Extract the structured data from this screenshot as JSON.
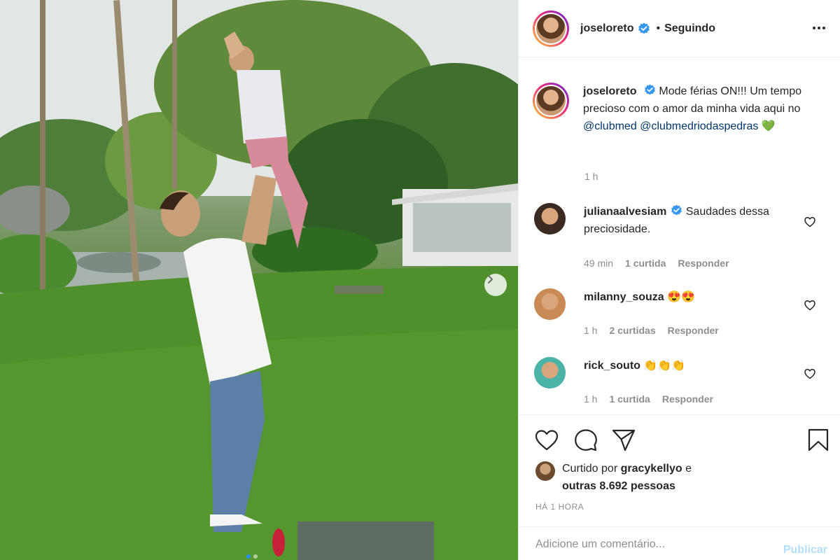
{
  "post": {
    "author": "joseloreto",
    "follow_status": "Seguindo",
    "separator": "•",
    "caption": {
      "text_before": "Mode férias ON!!! Um tempo precioso com o amor da minha vida aqui no",
      "mention_1": "@clubmed",
      "mention_2": "@clubmedriodaspedras",
      "emoji": "💚",
      "time": "1 h"
    }
  },
  "comments": [
    {
      "user": "julianaalvesiam",
      "verified": true,
      "text": "Saudades dessa preciosidade.",
      "time": "49 min",
      "likes": "1 curtida",
      "reply": "Responder",
      "avatar_color": "#3b2a22"
    },
    {
      "user": "milanny_souza",
      "verified": false,
      "text": "😍😍",
      "time": "1 h",
      "likes": "2 curtidas",
      "reply": "Responder",
      "avatar_color": "#c98a55"
    },
    {
      "user": "rick_souto",
      "verified": false,
      "text": "👏👏👏",
      "time": "1 h",
      "likes": "1 curtida",
      "reply": "Responder",
      "avatar_color": "#4bb3a8"
    }
  ],
  "likes": {
    "prefix": "Curtido por",
    "user": "gracykellyo",
    "connector": "e",
    "others": "outras 8.692 pessoas"
  },
  "timestamp": "HÁ 1 HORA",
  "add_comment": {
    "placeholder": "Adicione um comentário...",
    "publish_label": "Publicar"
  },
  "icons": {
    "more": "more-horizontal-icon",
    "verified": "verified-badge-icon",
    "like": "heart-icon",
    "comment": "comment-bubble-icon",
    "share": "paper-plane-icon",
    "save": "bookmark-icon",
    "next": "chevron-right-icon"
  },
  "colors": {
    "verified": "#3897f0",
    "link": "#00376b",
    "muted": "#8e8e8e",
    "publish_disabled": "#b2dffc"
  }
}
